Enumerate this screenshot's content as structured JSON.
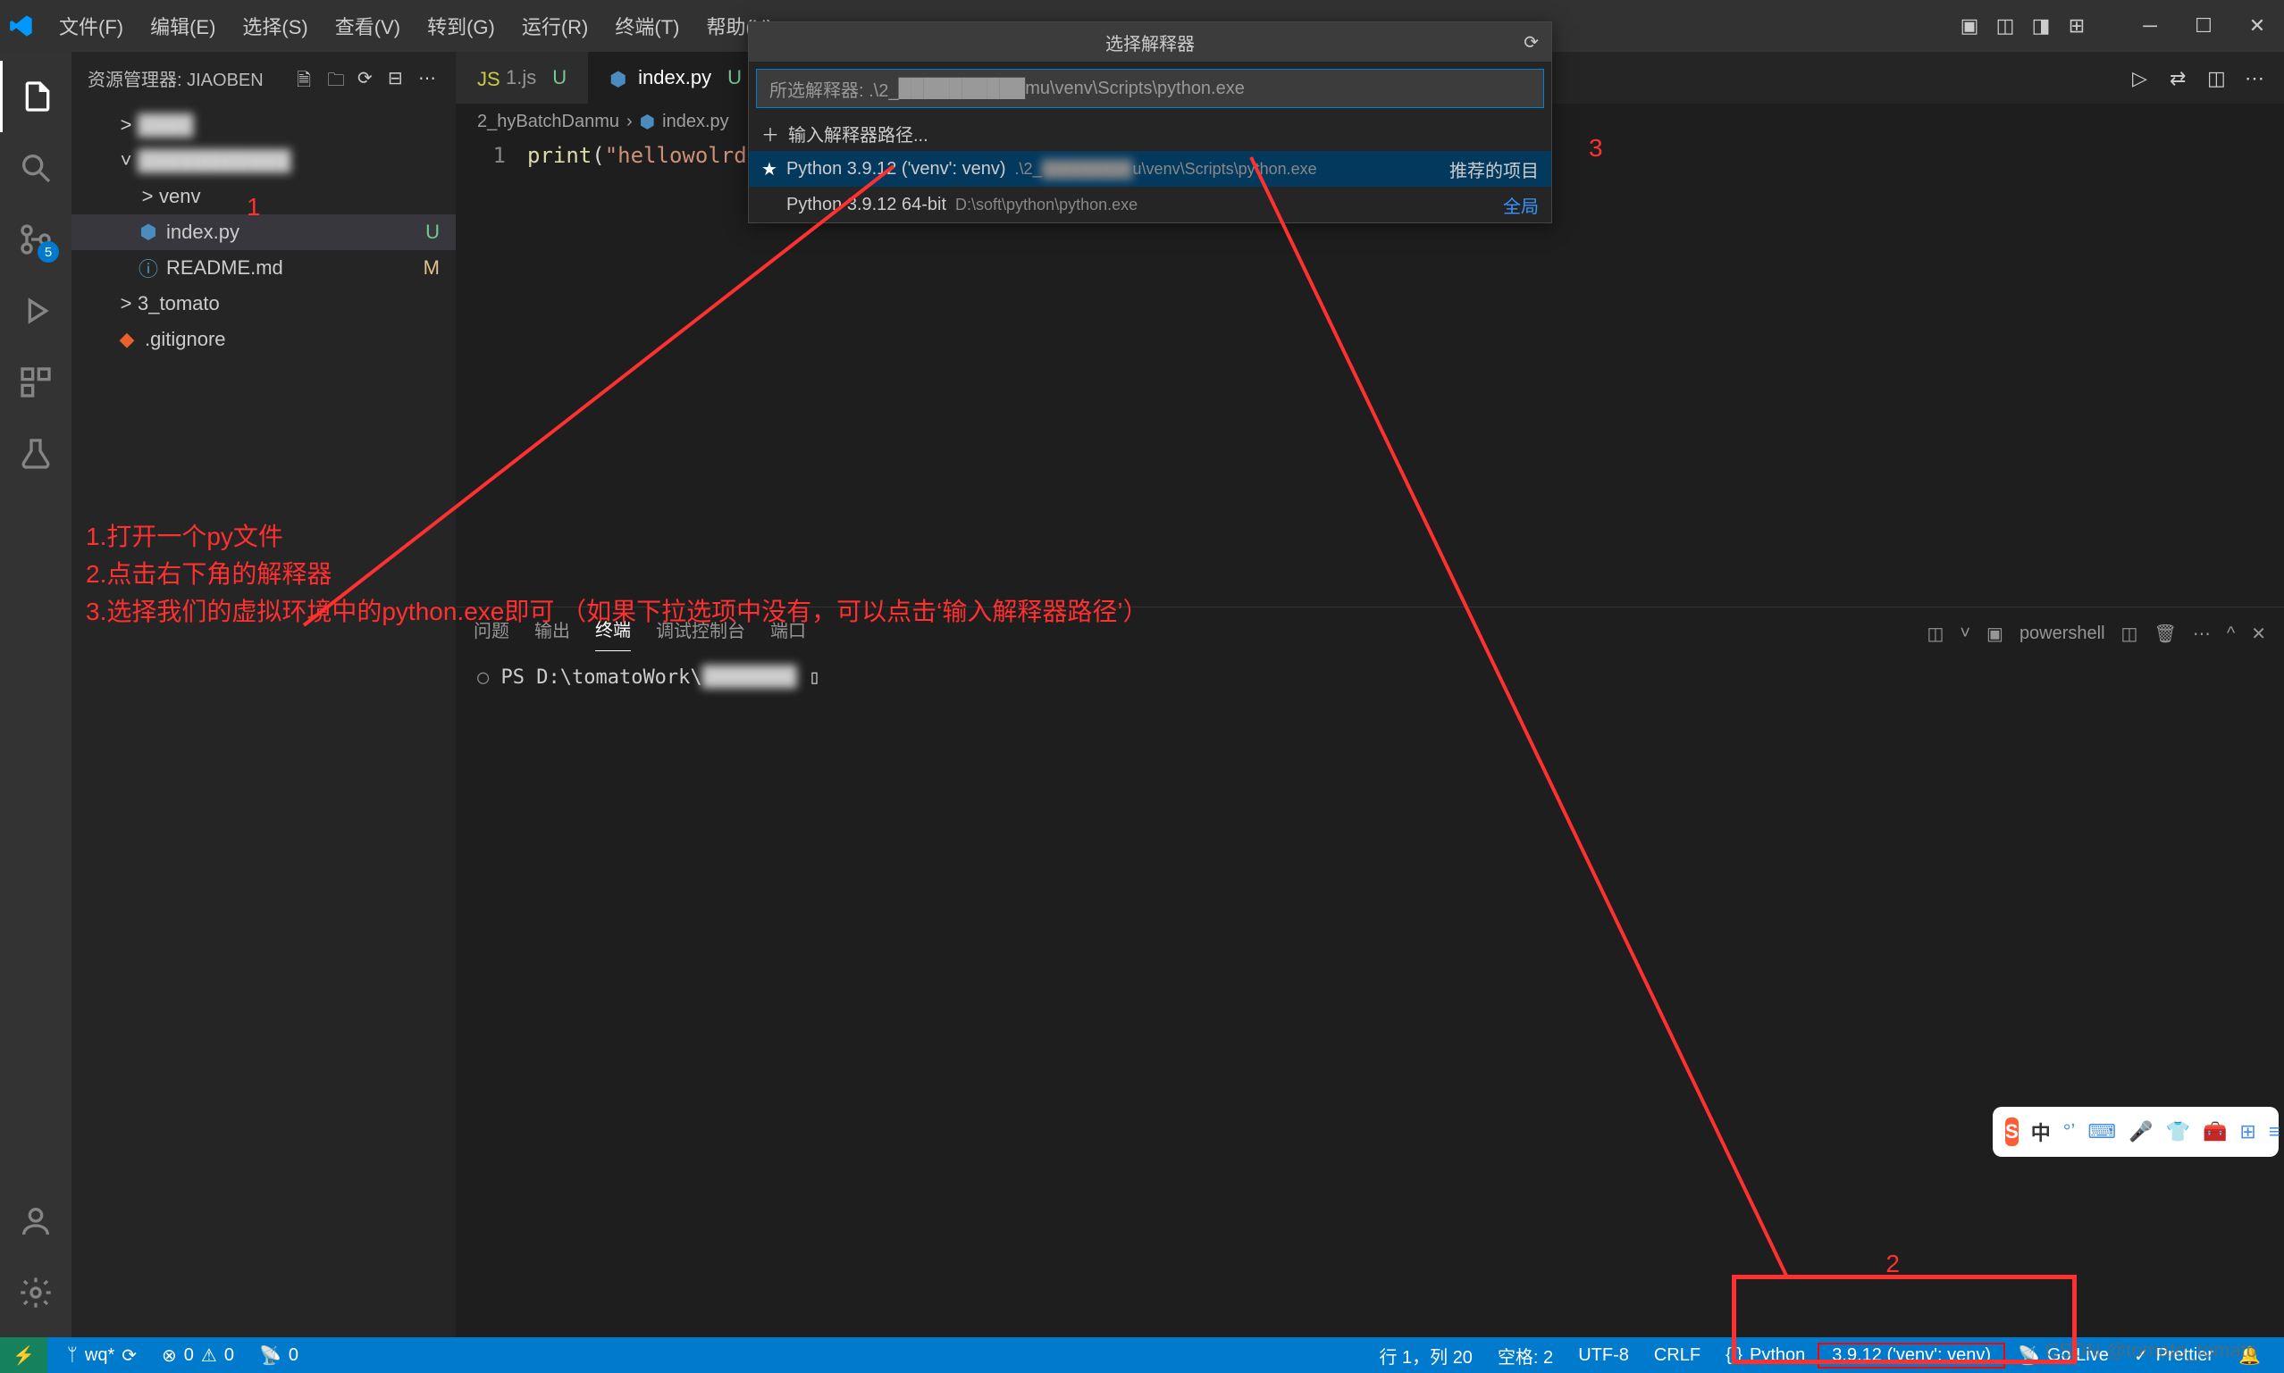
{
  "titlebar": {
    "menus": [
      "文件(F)",
      "编辑(E)",
      "选择(S)",
      "查看(V)",
      "转到(G)",
      "运行(R)",
      "终端(T)",
      "帮助(H)"
    ]
  },
  "activitybar": {
    "scm_badge": "5"
  },
  "sidebar": {
    "title": "资源管理器: JIAOBEN",
    "items": [
      {
        "chevron": ">",
        "label": "",
        "indent": 1,
        "blur": true
      },
      {
        "chevron": "˅",
        "label": "",
        "indent": 1,
        "blur": true
      },
      {
        "chevron": ">",
        "label": "venv",
        "indent": 2
      },
      {
        "icon": "py",
        "label": "index.py",
        "indent": 2,
        "active": true,
        "status": "U",
        "statusClass": "status-u"
      },
      {
        "icon": "info",
        "label": "README.md",
        "indent": 2,
        "status": "M",
        "statusClass": "status-m"
      },
      {
        "chevron": ">",
        "label": "3_tomato",
        "indent": 1
      },
      {
        "icon": "git",
        "label": ".gitignore",
        "indent": 1
      }
    ]
  },
  "tabs": [
    {
      "icon": "js",
      "label": "1.js",
      "status": "U"
    },
    {
      "icon": "py",
      "label": "index.py",
      "status": "U",
      "active": true
    }
  ],
  "breadcrumb": [
    "2_hyBatchDanmu",
    "index.py"
  ],
  "editor": {
    "line_no": "1",
    "code_fn": "print",
    "code_str": "\"hellowolrd\""
  },
  "terminal": {
    "tabs": [
      "问题",
      "输出",
      "终端",
      "调试控制台",
      "端口"
    ],
    "active_tab": 2,
    "shell_label": "powershell",
    "prompt_prefix": "PS D:\\tomatoWork\\",
    "prompt_blur": "█████████",
    "cursor": "▯"
  },
  "picker": {
    "title": "选择解释器",
    "placeholder_prefix": "所选解释器: .\\2_",
    "placeholder_suffix": "mu\\venv\\Scripts\\python.exe",
    "enter_path": "输入解释器路径...",
    "rows": [
      {
        "star": true,
        "label": "Python 3.9.12 ('venv': venv)",
        "path_prefix": ".\\2_",
        "path_suffix": "u\\venv\\Scripts\\python.exe",
        "tag": "推荐的项目",
        "selected": true
      },
      {
        "label": "Python 3.9.12 64-bit",
        "path": "D:\\soft\\python\\python.exe",
        "tag": "全局"
      }
    ]
  },
  "statusbar": {
    "branch": "wq*",
    "sync": "⟳",
    "errors": "0",
    "warnings": "0",
    "radio": "0",
    "ln_col": "行 1，列 20",
    "spaces": "空格: 2",
    "encoding": "UTF-8",
    "eol": "CRLF",
    "lang": "Python",
    "interpreter": "3.9.12 ('venv': venv)",
    "golive": "Go Live",
    "prettier": "Prettier"
  },
  "annotations": {
    "num1": "1",
    "num2": "2",
    "num3": "3",
    "text_block": "1.打开一个py文件\n2.点击右下角的解释器\n3.选择我们的虚拟环境中的python.exe即可 （如果下拉选项中没有，可以点击‘输入解释器路径’）"
  },
  "ime": {
    "lang": "中"
  },
  "watermark": "CSDN @tomato_tomato"
}
